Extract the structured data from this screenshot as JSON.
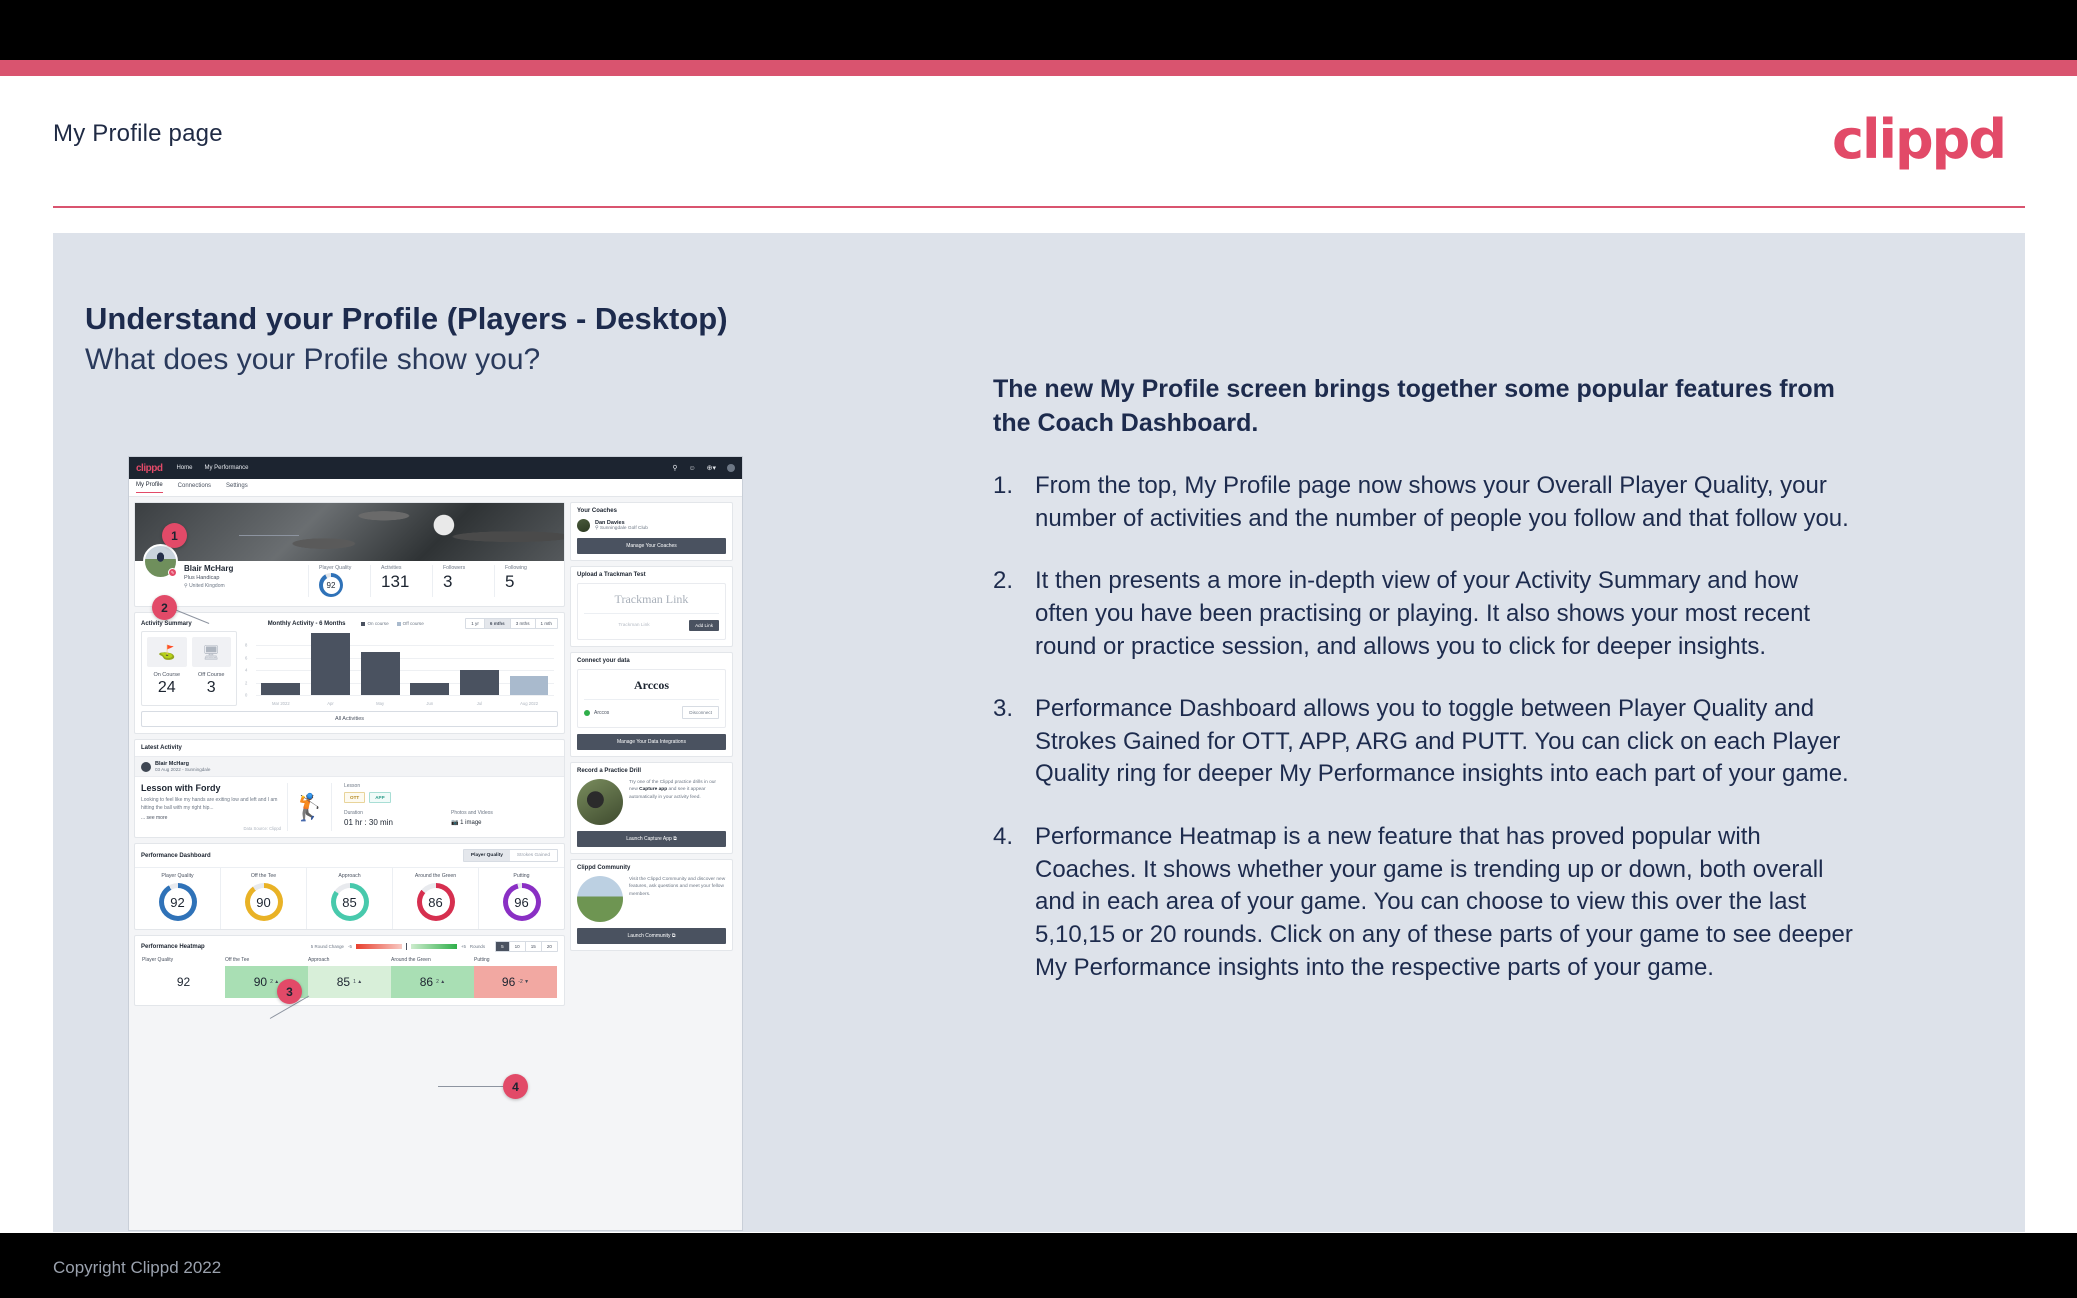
{
  "slide": {
    "title": "My Profile page",
    "brand": "clippd",
    "heading": "Understand your Profile (Players - Desktop)",
    "subheading": "What does your Profile show you?",
    "copyright": "Copyright Clippd 2022"
  },
  "copy": {
    "lead": "The new My Profile screen brings together some popular features from the Coach Dashboard.",
    "items": [
      {
        "num": "1.",
        "text": "From the top, My Profile page now shows your Overall Player Quality, your number of activities and the number of people you follow and that follow you."
      },
      {
        "num": "2.",
        "text": "It then presents a more in-depth view of your Activity Summary and how often you have been practising or playing. It also shows your most recent round or practice session, and allows you to click for deeper insights."
      },
      {
        "num": "3.",
        "text": "Performance Dashboard allows you to toggle between Player Quality and Strokes Gained for OTT, APP, ARG and PUTT. You can click on each Player Quality ring for deeper My Performance insights into each part of your game."
      },
      {
        "num": "4.",
        "text": "Performance Heatmap is a new feature that has proved popular with Coaches. It shows whether your game is trending up or down, both overall and in each area of your game. You can choose to view this over the last 5,10,15 or 20 rounds. Click on any of these parts of your game to see deeper My Performance insights into the respective parts of your game."
      }
    ]
  },
  "callouts": [
    {
      "label": "1"
    },
    {
      "label": "2"
    },
    {
      "label": "3"
    },
    {
      "label": "4"
    }
  ],
  "app": {
    "nav": {
      "logo": "clippd",
      "links": [
        "Home",
        "My Performance"
      ],
      "icons": [
        "search-icon",
        "people-icon",
        "add-circle-icon",
        "avatar"
      ]
    },
    "tabs": [
      {
        "label": "My Profile",
        "active": true
      },
      {
        "label": "Connections",
        "active": false
      },
      {
        "label": "Settings",
        "active": false
      }
    ],
    "profile": {
      "name": "Blair McHarg",
      "handicap": "Plus Handicap",
      "location": "United Kingdom",
      "stats": [
        {
          "label": "Player Quality",
          "value": "92",
          "type": "ring",
          "color": "#2f72b8"
        },
        {
          "label": "Activities",
          "value": "131"
        },
        {
          "label": "Followers",
          "value": "3"
        },
        {
          "label": "Following",
          "value": "5"
        }
      ]
    },
    "activity_summary": {
      "title": "Activity Summary",
      "chart_title": "Monthly Activity - 6 Months",
      "legend": [
        {
          "label": "On course",
          "color": "#4a5260"
        },
        {
          "label": "Off course",
          "color": "#a9bacd"
        }
      ],
      "ranges": [
        {
          "label": "1 yr",
          "active": false
        },
        {
          "label": "6 mths",
          "active": true
        },
        {
          "label": "3 mths",
          "active": false
        },
        {
          "label": "1 mth",
          "active": false
        }
      ],
      "on_course": {
        "label": "On Course",
        "value": "24"
      },
      "off_course": {
        "label": "Off Course",
        "value": "3"
      },
      "all_activities_label": "All Activities"
    },
    "latest_activity": {
      "title": "Latest Activity",
      "author": "Blair McHarg",
      "meta": "03 Aug 2022 - Sunningdale",
      "headline": "Lesson with Fordy",
      "body": "Looking to feel like my hands are exiting low and left and I am hitting the ball with my right hip...",
      "see_more": "... see more",
      "data_source": "Data Source: Clippd",
      "type_label": "Lesson",
      "tags": [
        "OTT",
        "APP"
      ],
      "duration_label": "Duration",
      "duration_value": "01 hr : 30 min",
      "photos_label": "Photos and Videos",
      "photos_value": "1 image"
    },
    "performance_dashboard": {
      "title": "Performance Dashboard",
      "toggles": [
        {
          "label": "Player Quality",
          "active": true
        },
        {
          "label": "Strokes Gained",
          "active": false
        }
      ],
      "rings": [
        {
          "label": "Player Quality",
          "value": "92",
          "color": "#2f72b8"
        },
        {
          "label": "Off the Tee",
          "value": "90",
          "color": "#e9b226"
        },
        {
          "label": "Approach",
          "value": "85",
          "color": "#48c9ac"
        },
        {
          "label": "Around the Green",
          "value": "86",
          "color": "#d62f4f"
        },
        {
          "label": "Putting",
          "value": "96",
          "color": "#8a2fc4"
        }
      ]
    },
    "performance_heatmap": {
      "title": "Performance Heatmap",
      "scale_label": "5 Round Change",
      "scale_min": "-5",
      "scale_max": "+5",
      "rounds_label": "Rounds",
      "rounds": [
        {
          "label": "5",
          "active": true
        },
        {
          "label": "10",
          "active": false
        },
        {
          "label": "15",
          "active": false
        },
        {
          "label": "20",
          "active": false
        }
      ],
      "cells": [
        {
          "label": "Player Quality",
          "value": "92",
          "delta": "",
          "bg": "#ffffff"
        },
        {
          "label": "Off the Tee",
          "value": "90",
          "delta": "2 ▲",
          "bg": "#a9dfb4"
        },
        {
          "label": "Approach",
          "value": "85",
          "delta": "1 ▲",
          "bg": "#d8efd9"
        },
        {
          "label": "Around the Green",
          "value": "86",
          "delta": "2 ▲",
          "bg": "#a9dfb4"
        },
        {
          "label": "Putting",
          "value": "96",
          "delta": "-2 ▼",
          "bg": "#f2a8a2"
        }
      ]
    },
    "sidebar": {
      "coaches": {
        "title": "Your Coaches",
        "coach_name": "Dan Davies",
        "coach_club": "Sunningdale Golf Club",
        "button": "Manage Your Coaches"
      },
      "trackman": {
        "title": "Upload a Trackman Test",
        "brand": "Trackman Link",
        "placeholder": "Trackman Link",
        "button": "Add Link"
      },
      "data": {
        "title": "Connect your data",
        "brand": "Arccos",
        "status_name": "Arccos",
        "disconnect": "Disconnect",
        "button": "Manage Your Data Integrations"
      },
      "practice": {
        "title": "Record a Practice Drill",
        "body_pre": "Try one of the Clippd practice drills in our new ",
        "body_bold": "Capture app",
        "body_post": " and see it appear automatically in your activity feed.",
        "button": "Launch Capture App ⧉"
      },
      "community": {
        "title": "Clippd Community",
        "body": "Visit the Clippd Community and discover new features, ask questions and meet your fellow members.",
        "button": "Launch Community ⧉"
      }
    }
  },
  "chart_data": {
    "type": "bar",
    "title": "Monthly Activity - 6 Months",
    "categories": [
      "Mar 2022",
      "Apr",
      "May",
      "Jun",
      "Jul",
      "Aug 2022"
    ],
    "values": [
      2,
      10,
      7,
      2,
      4,
      3
    ],
    "bar_colors": [
      "#4a5260",
      "#4a5260",
      "#4a5260",
      "#4a5260",
      "#4a5260",
      "#a9bacd"
    ],
    "series": [
      {
        "name": "On course",
        "values": [
          2,
          10,
          7,
          2,
          4,
          null
        ]
      },
      {
        "name": "Off course",
        "values": [
          null,
          null,
          null,
          null,
          null,
          3
        ]
      }
    ],
    "xlabel": "",
    "ylabel": "",
    "ylim": [
      0,
      10
    ],
    "yticks": [
      0,
      2,
      4,
      6,
      8
    ],
    "grid": true,
    "legend_position": "top"
  }
}
